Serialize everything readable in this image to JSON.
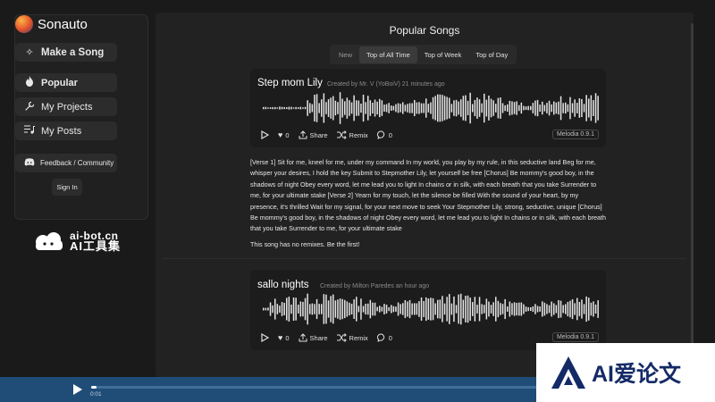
{
  "brand": {
    "name": "Sonauto"
  },
  "sidebar": {
    "make_song": "Make a Song",
    "nav": [
      {
        "label": "Popular",
        "icon": "flame-icon",
        "active": true
      },
      {
        "label": "My Projects",
        "icon": "wrench-icon",
        "active": false
      },
      {
        "label": "My Posts",
        "icon": "playlist-icon",
        "active": false
      }
    ],
    "feedback": "Feedback / Community",
    "sign_in": "Sign In"
  },
  "watermarks": {
    "left_url": "ai-bot.cn",
    "left_cn": "AI工具集",
    "right_text": "AI爱论文"
  },
  "main": {
    "title": "Popular Songs",
    "tabs": [
      {
        "label": "New",
        "active": false
      },
      {
        "label": "Top of All Time",
        "active": true
      },
      {
        "label": "Top of Week",
        "active": false
      },
      {
        "label": "Top of Day",
        "active": false
      }
    ]
  },
  "songs": [
    {
      "title": "Step mom Lily",
      "created": "Created by Mr. V (YoBoiV) 21 minutes ago",
      "likes": "0",
      "share": "Share",
      "remix": "Remix",
      "comments": "0",
      "model": "Melodia 0.9.1",
      "lyrics": "[Verse 1] Sit for me, kneel for me, under my command In my world, you play by my rule, in this seductive land Beg for me, whisper your desires, I hold the key Submit to Stepmother Lily, let yourself be free [Chorus] Be mommy's good boy, in the shadows of night Obey every word, let me lead you to light In chains or in silk, with each breath that you take Surrender to me, for your ultimate stake [Verse 2] Yearn for my touch, let the silence be filled With the sound of your heart, by my presence, it's thrilled Wait for my signal, for your next move to seek Your Stepmother Lily, strong, seductive, unique [Chorus] Be mommy's good boy, in the shadows of night Obey every word, let me lead you to light In chains or in silk, with each breath that you take Surrender to me, for your ultimate stake",
      "remix_note": "This song has no remixes. Be the first!"
    },
    {
      "title": "sallo nights",
      "created": "Created by Milton Paredes an hour ago",
      "likes": "0",
      "share": "Share",
      "remix": "Remix",
      "comments": "0",
      "model": "Melodia 0.9.1"
    }
  ],
  "player": {
    "time": "0:01",
    "progress": 0.01
  },
  "colors": {
    "player_bg": "#1f4d78",
    "background": "#1a1a1a",
    "wave": "#e6e6e6"
  }
}
